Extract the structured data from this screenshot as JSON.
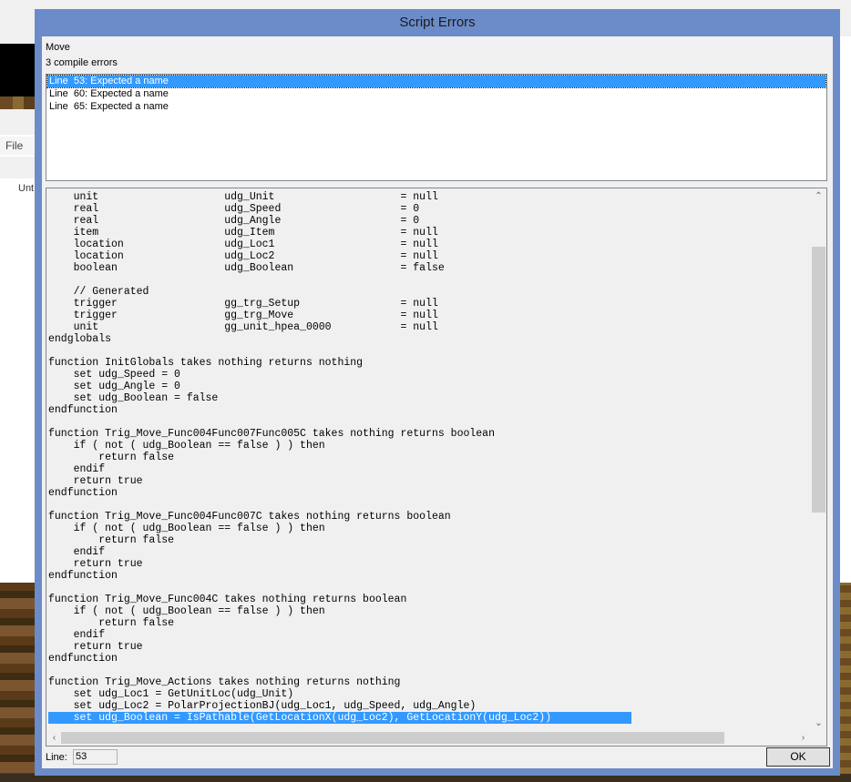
{
  "background": {
    "menu_file": "File",
    "tree_item": "Unt"
  },
  "dialog": {
    "title": "Script Errors",
    "trigger_name": "Move",
    "error_count": "3 compile errors",
    "errors": [
      "Line  53: Expected a name",
      "Line  60: Expected a name",
      "Line  65: Expected a name"
    ],
    "selected_error_index": 0,
    "code_lines": [
      "    unit                    udg_Unit                    = null",
      "    real                    udg_Speed                   = 0",
      "    real                    udg_Angle                   = 0",
      "    item                    udg_Item                    = null",
      "    location                udg_Loc1                    = null",
      "    location                udg_Loc2                    = null",
      "    boolean                 udg_Boolean                 = false",
      "",
      "    // Generated",
      "    trigger                 gg_trg_Setup                = null",
      "    trigger                 gg_trg_Move                 = null",
      "    unit                    gg_unit_hpea_0000           = null",
      "endglobals",
      "",
      "function InitGlobals takes nothing returns nothing",
      "    set udg_Speed = 0",
      "    set udg_Angle = 0",
      "    set udg_Boolean = false",
      "endfunction",
      "",
      "function Trig_Move_Func004Func007Func005C takes nothing returns boolean",
      "    if ( not ( udg_Boolean == false ) ) then",
      "        return false",
      "    endif",
      "    return true",
      "endfunction",
      "",
      "function Trig_Move_Func004Func007C takes nothing returns boolean",
      "    if ( not ( udg_Boolean == false ) ) then",
      "        return false",
      "    endif",
      "    return true",
      "endfunction",
      "",
      "function Trig_Move_Func004C takes nothing returns boolean",
      "    if ( not ( udg_Boolean == false ) ) then",
      "        return false",
      "    endif",
      "    return true",
      "endfunction",
      "",
      "function Trig_Move_Actions takes nothing returns nothing",
      "    set udg_Loc1 = GetUnitLoc(udg_Unit)",
      "    set udg_Loc2 = PolarProjectionBJ(udg_Loc1, udg_Speed, udg_Angle)",
      "    set udg_Boolean = IsPathable(GetLocationX(udg_Loc2), GetLocationY(udg_Loc2))"
    ],
    "highlighted_line_index": 44,
    "line_label": "Line:",
    "line_value": "53",
    "ok_label": "OK"
  }
}
